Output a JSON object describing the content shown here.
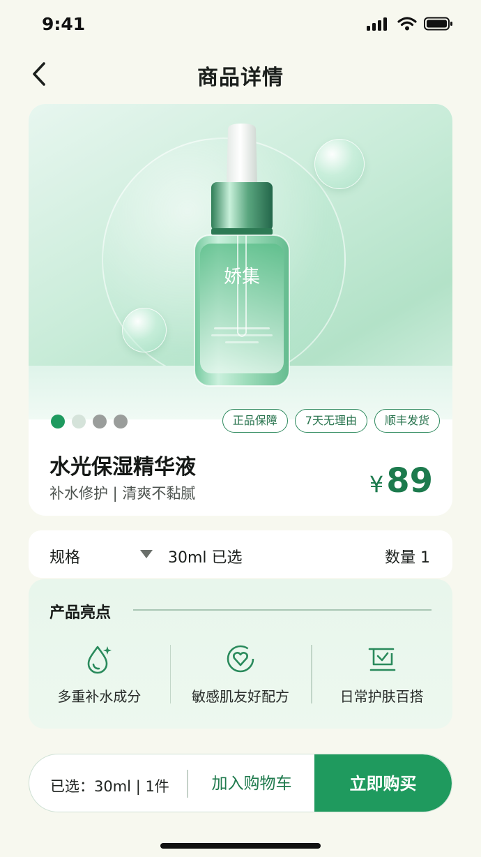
{
  "status_bar": {
    "time": "9:41"
  },
  "nav": {
    "title": "商品详情"
  },
  "product": {
    "brand": "娇集",
    "name": "水光保湿精华液",
    "subtitle": "补水修护 | 清爽不黏腻",
    "price_symbol": "¥",
    "price": "89",
    "tags": [
      "正品保障",
      "7天无理由",
      "顺丰发货"
    ],
    "image_count": 4,
    "active_image": 1
  },
  "spec": {
    "label": "规格",
    "value": "30ml 已选",
    "quantity": "数量  1"
  },
  "highlights": {
    "title": "产品亮点",
    "items": [
      {
        "icon": "water-drop-sparkle-icon",
        "label": "多重补水成分"
      },
      {
        "icon": "gentle-heart-shield-icon",
        "label": "敏感肌友好配方"
      },
      {
        "icon": "daily-care-basket-icon",
        "label": "日常护肤百搭"
      }
    ]
  },
  "bottom_bar": {
    "selected": "已选：30ml | 1件",
    "add_to_cart": "加入购物车",
    "buy_now": "立即购买"
  },
  "colors": {
    "accent": "#1f9a5e",
    "price": "#1c7a4d",
    "background": "#f7f8ef"
  }
}
